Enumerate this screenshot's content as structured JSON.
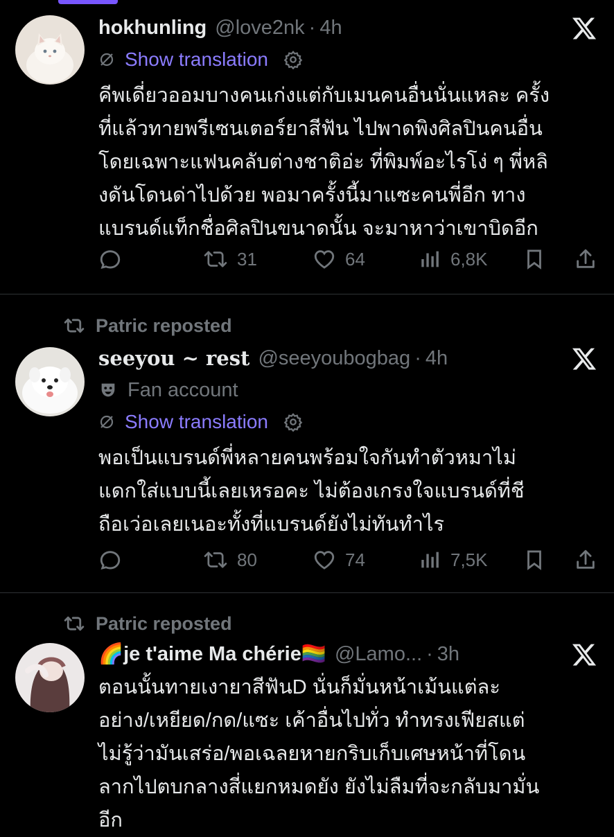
{
  "tweets": [
    {
      "display_name": "hokhunling",
      "handle": "@love2nk",
      "separator": "·",
      "time": "4h",
      "show_translation": "Show translation",
      "text": "คีพเดี่ยวออมบางคนเก่งแต่กับเมนคนอื่นนั่นแหละ ครั้ง\nที่แล้วทายพรีเซนเตอร์ยาสีฟัน ไปพาดพิงศิลปินคนอื่น\nโดยเฉพาะแฟนคลับต่างชาติอ่ะ ที่พิมพ์อะไรโง่ ๆ พี่หลิ\nงดันโดนด่าไปด้วย พอมาครั้งนี้มาแซะคนพี่อีก ทาง\nแบรนด์แท็กชื่อศิลปินขนาดนั้น จะมาหาว่าเขาบิดอีก",
      "retweets": "31",
      "likes": "64",
      "views": "6,8K"
    },
    {
      "reposted_by": "Patric reposted",
      "display_name": "seeyou ~ rest",
      "handle": "@seeyoubogbag",
      "separator": "·",
      "time": "4h",
      "label": "Fan account",
      "show_translation": "Show translation",
      "text": "พอเป็นแบรนด์พี่หลายคนพร้อมใจกันทำตัวหมาไม่\nแดกใส่แบบนี้เลยเหรอคะ ไม่ต้องเกรงใจแบรนด์ที่ชี\nถือเว่อเลยเนอะทั้งที่แบรนด์ยังไม่ทันทำไร",
      "retweets": "80",
      "likes": "74",
      "views": "7,5K"
    },
    {
      "reposted_by": "Patric reposted",
      "display_name": "🌈je t'aime Ma chérie🏳️‍🌈",
      "handle": "@Lamo...",
      "separator": "·",
      "time": "3h",
      "text": "ตอนนั้นทายเงายาสีฟันD นั่นก็มั่นหน้าเม้นแต่ละ\nอย่าง/เหยียด/กด/แซะ เค้าอื่นไปทั่ว ทำทรงเฟียสแต่\nไม่รู้ว่ามันเสร่อ/พอเฉลยหายกริบเก็บเศษหน้าที่โดน\nลากไปตบกลางสี่แยกหมดยัง ยังไม่ลืมที่จะกลับมามั่น\nอีก"
    }
  ],
  "colors": {
    "background": "#000000",
    "text": "#e7e9ea",
    "muted": "#71767b",
    "link": "#8b7cff",
    "divider": "#2f3336"
  }
}
